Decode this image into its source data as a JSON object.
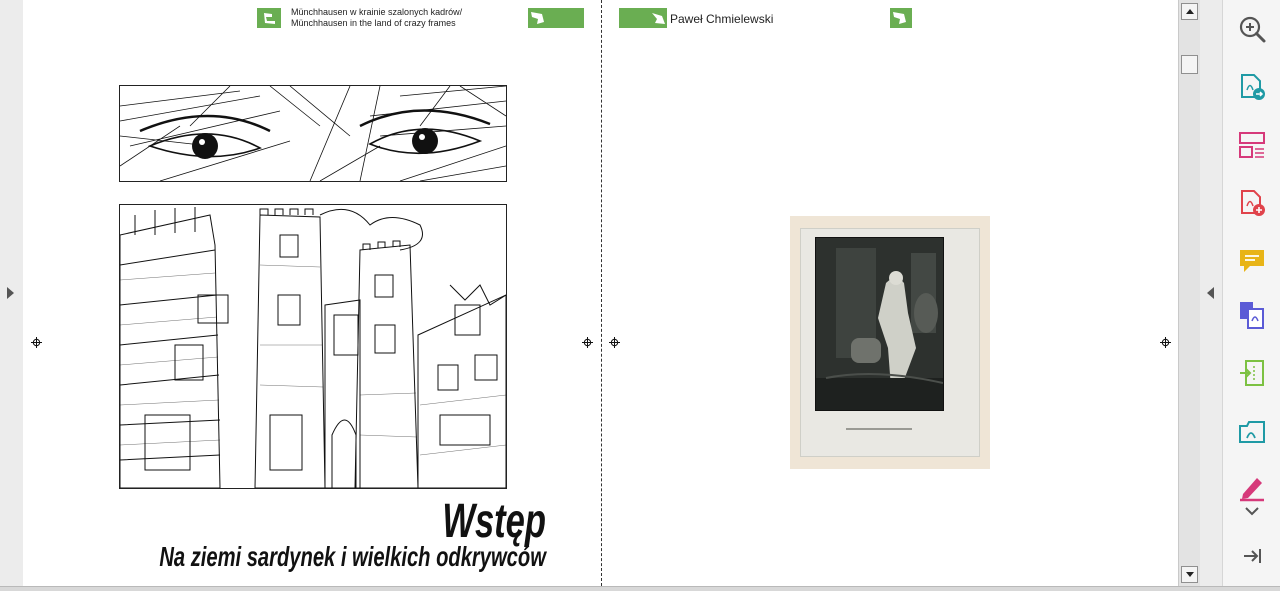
{
  "header": {
    "left_line1": "Münchhausen w krainie szalonych kadrów/",
    "left_line2": "Münchhausen in the land of crazy frames",
    "right_author": "Paweł Chmielewski"
  },
  "page_left": {
    "title": "Wstęp",
    "subtitle": "Na ziemi sardynek i wielkich odkrywców"
  },
  "toolbar": {
    "tools": [
      "zoom-in-icon",
      "export-pdf-icon",
      "organize-pages-icon",
      "create-pdf-icon",
      "comment-icon",
      "combine-files-icon",
      "compress-icon",
      "fill-sign-icon",
      "edit-pdf-icon",
      "more-tools-icon",
      "collapse-panel-icon"
    ]
  },
  "colors": {
    "accent_green": "#6aae52",
    "tool_teal": "#1f9aa5",
    "tool_pink": "#d6397a",
    "tool_red": "#e0434b",
    "tool_yellow": "#e8b417",
    "tool_purple": "#5b5bd6",
    "tool_lime": "#7cc142"
  }
}
